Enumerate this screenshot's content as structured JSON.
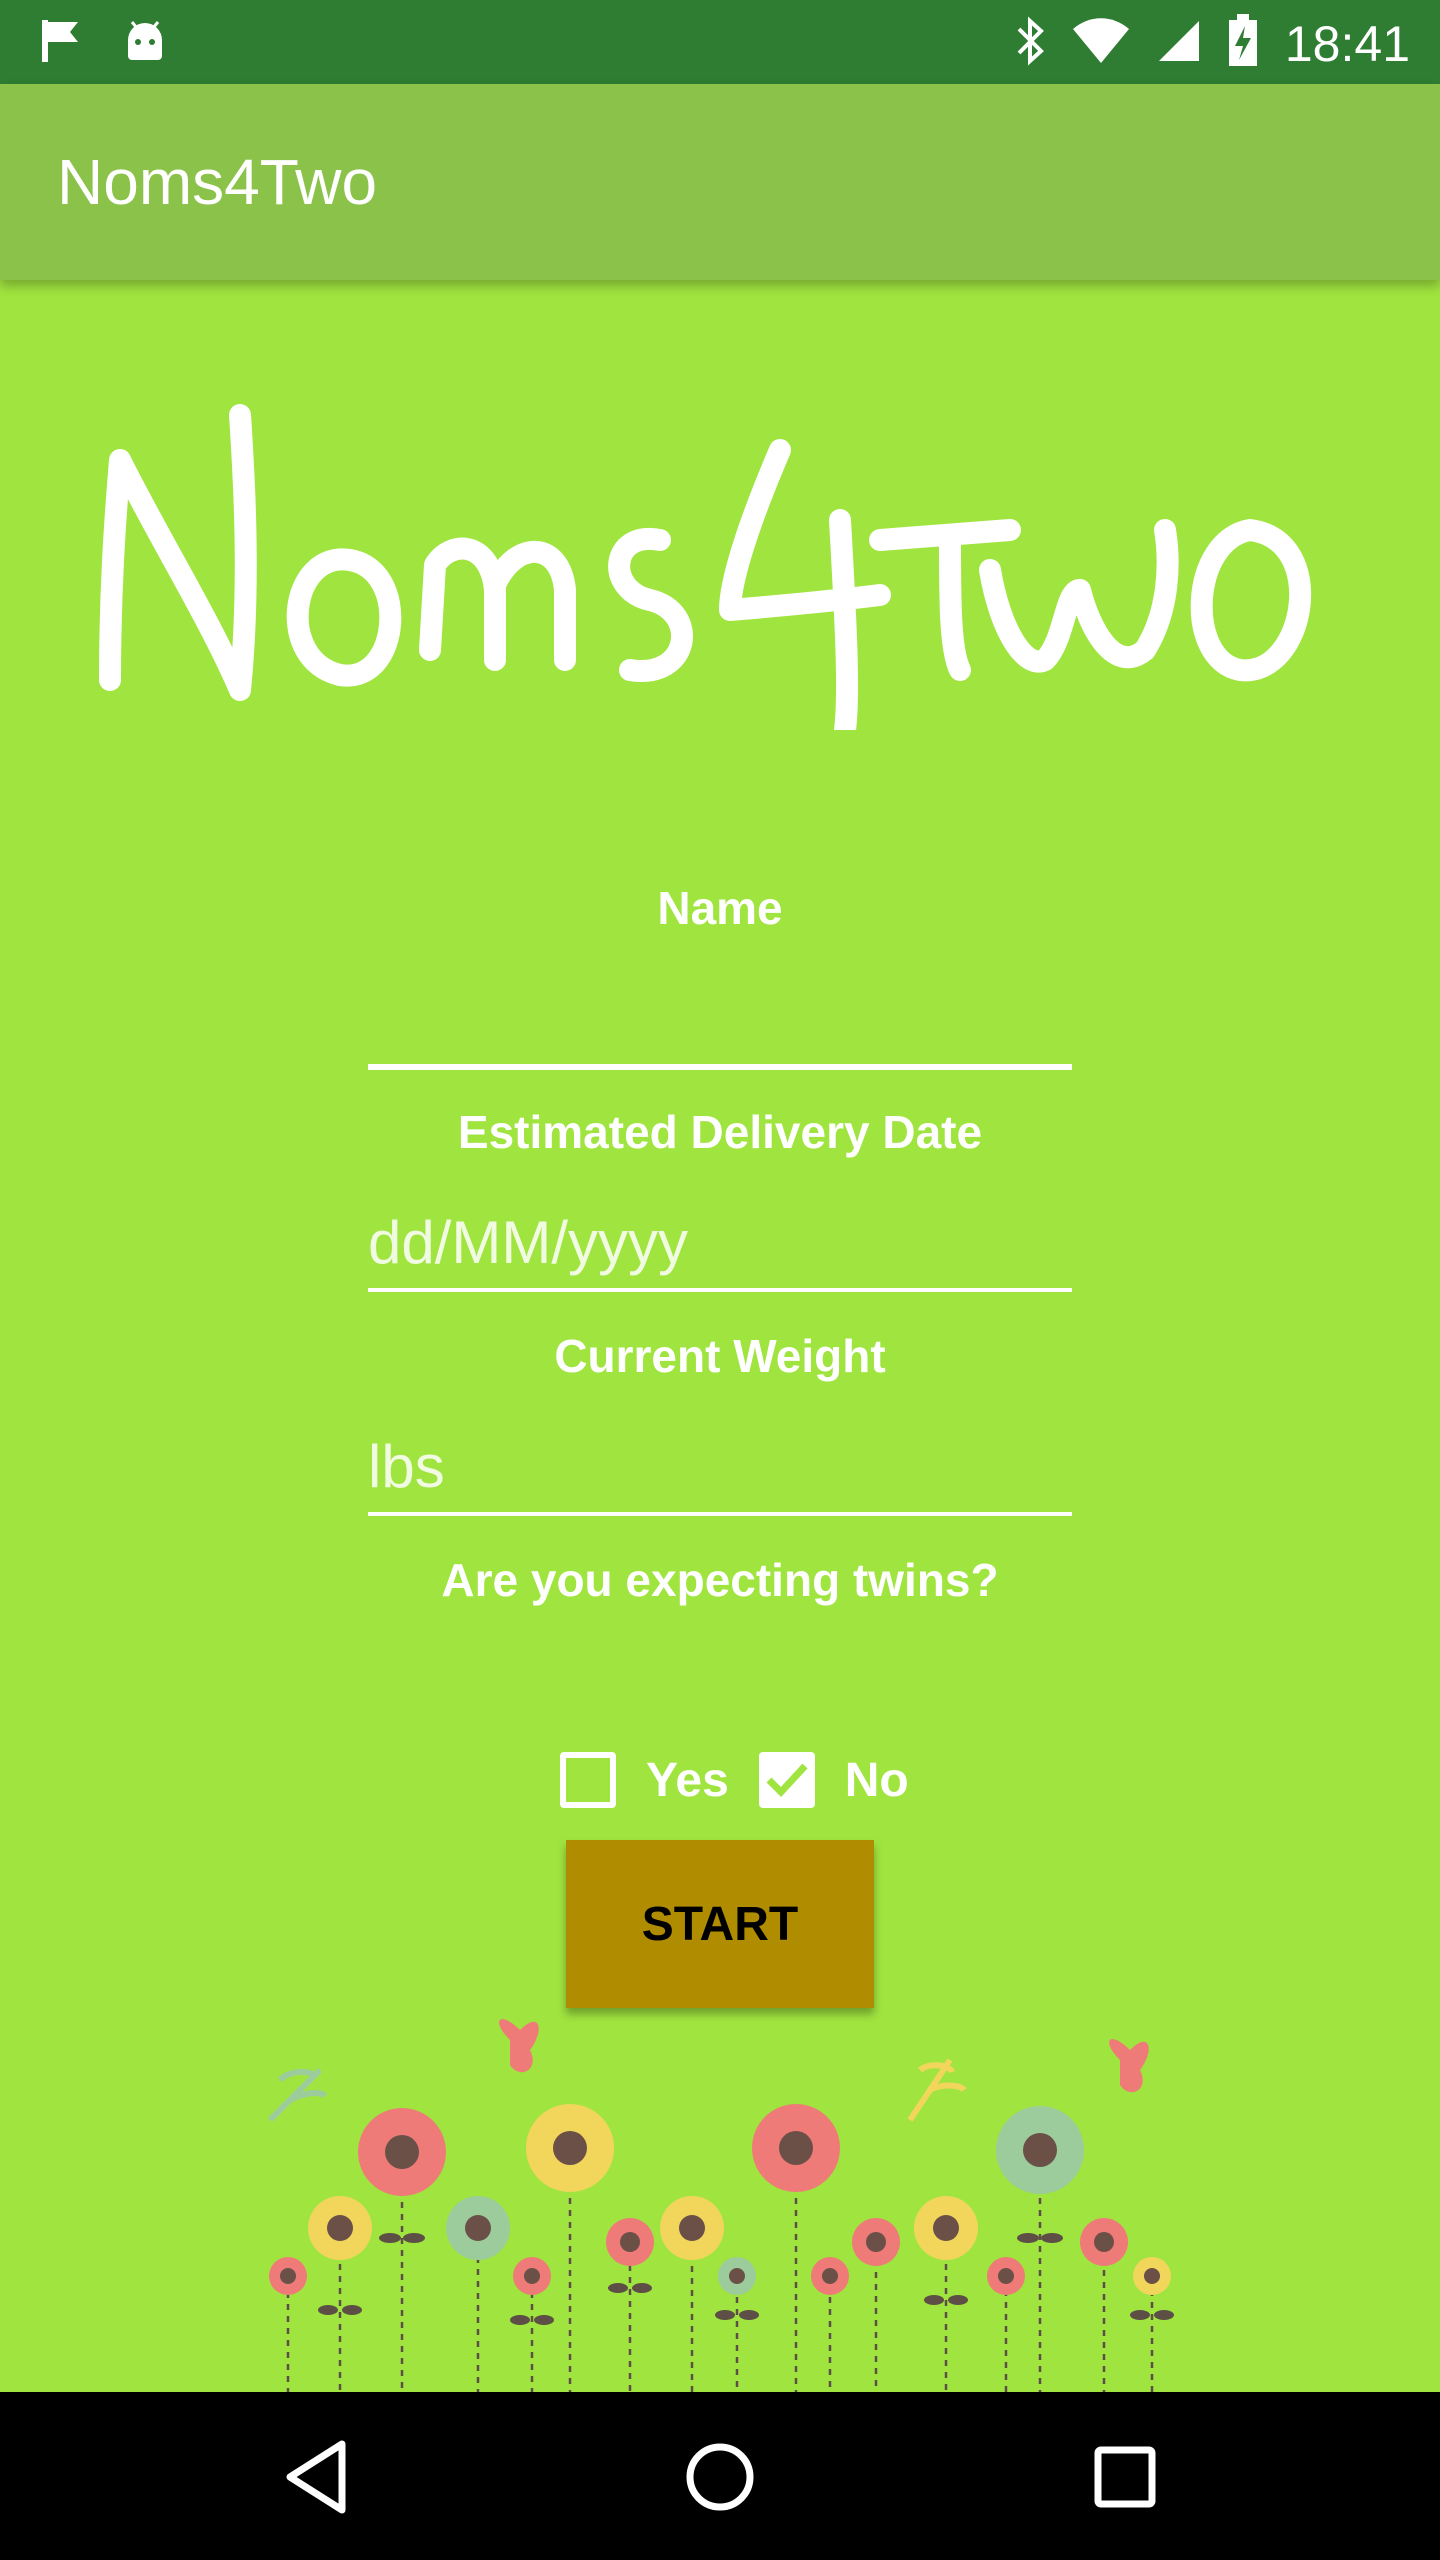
{
  "status_bar": {
    "time": "18:41",
    "left_icons": [
      "flag-icon",
      "android-icon"
    ],
    "right_icons": [
      "bluetooth-icon",
      "wifi-icon",
      "cell-signal-icon",
      "battery-charging-icon"
    ]
  },
  "app_bar": {
    "title": "Noms4Two"
  },
  "logo": {
    "text": "Noms4Two"
  },
  "form": {
    "name_label": "Name",
    "name_value": "",
    "delivery_label": "Estimated Delivery Date",
    "delivery_placeholder": "dd/MM/yyyy",
    "weight_label": "Current Weight",
    "weight_placeholder": "lbs",
    "twins_question": "Are you expecting twins?",
    "options": [
      {
        "label": "Yes",
        "checked": false
      },
      {
        "label": "No",
        "checked": true
      }
    ],
    "start_label": "START"
  },
  "colors": {
    "background": "#a0e43f",
    "app_bar": "#8bc34a",
    "status_bar": "#2e7d32",
    "start_button": "#b08c00"
  },
  "nav_bar": {
    "icons": [
      "back-icon",
      "home-icon",
      "recents-icon"
    ]
  }
}
